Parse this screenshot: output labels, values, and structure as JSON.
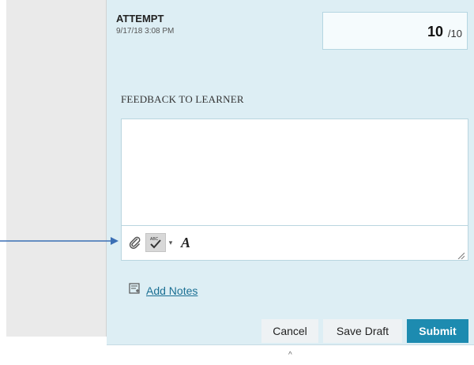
{
  "attempt": {
    "label": "ATTEMPT",
    "date": "9/17/18 3:08 PM"
  },
  "grade": {
    "score": "10",
    "total": "/10"
  },
  "feedback": {
    "label": "FEEDBACK TO LEARNER",
    "value": ""
  },
  "toolbar": {
    "icons": [
      "paperclip-icon",
      "spellcheck-icon",
      "chevron-down-icon",
      "text-format-icon",
      "resize-grip-icon"
    ],
    "format_glyph": "A",
    "caret_glyph": "▾"
  },
  "notes": {
    "link_label": "Add Notes",
    "icon": "notes-icon"
  },
  "actions": {
    "cancel_label": "Cancel",
    "save_draft_label": "Save Draft",
    "submit_label": "Submit"
  },
  "footer": {
    "collapse_glyph": "^"
  },
  "colors": {
    "panel_bg": "#ddeef4",
    "submit_bg": "#1d8bb0",
    "link": "#1a6f93",
    "arrow": "#3b6fb5"
  }
}
